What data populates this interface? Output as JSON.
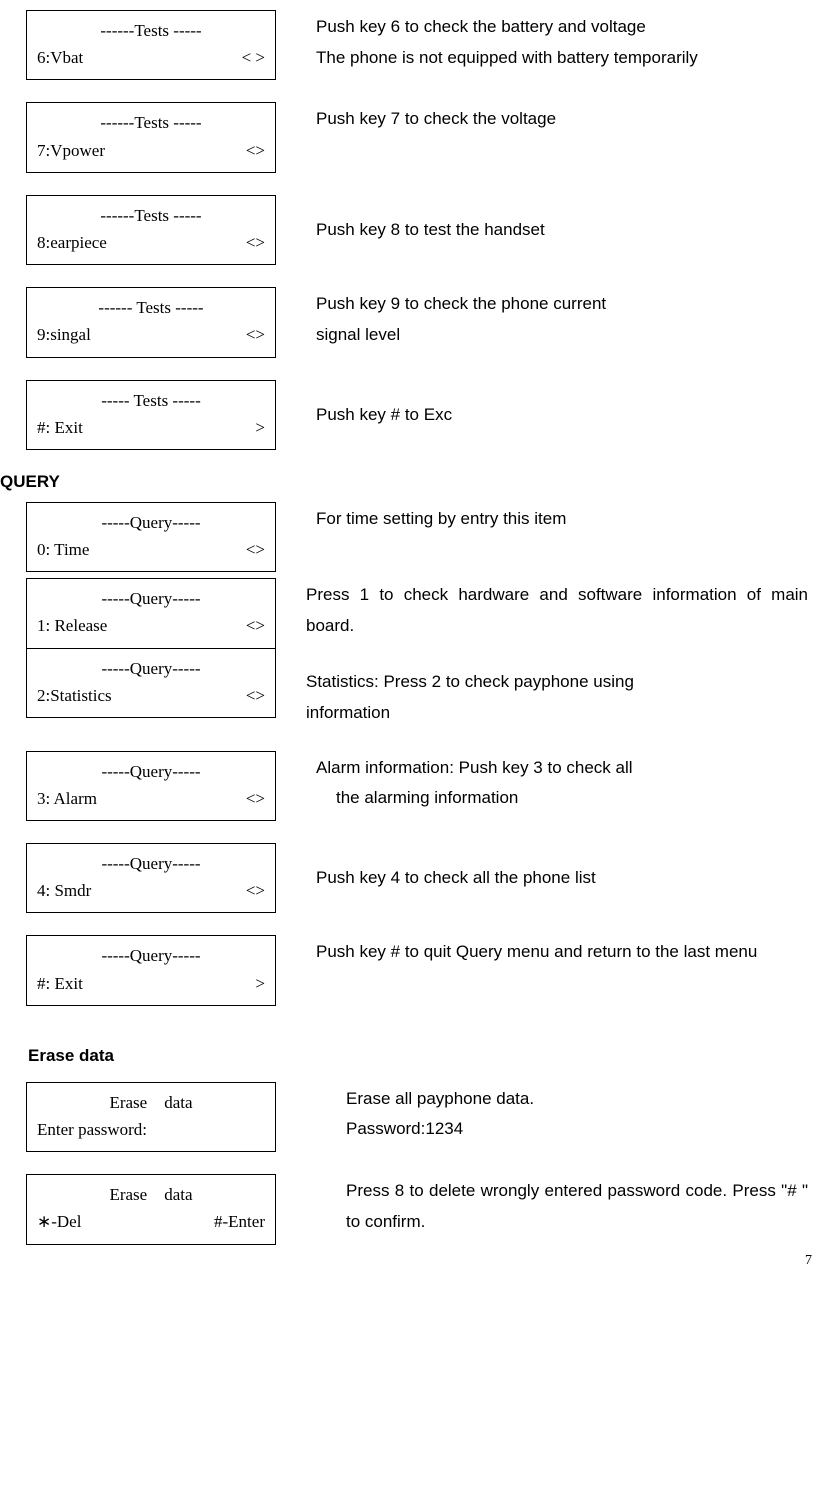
{
  "tests": [
    {
      "hdr": "------Tests -----",
      "left": "6:Vbat",
      "right": "< >",
      "desc": [
        "Push key 6 to check the battery and voltage",
        "The phone is not equipped with battery temporarily"
      ]
    },
    {
      "hdr": "------Tests -----",
      "left": "7:Vpower",
      "right": "<>",
      "desc": [
        "Push key 7 to check the voltage"
      ]
    },
    {
      "hdr": "------Tests -----",
      "left": "8:earpiece",
      "right": "<>",
      "desc": [
        "Push key 8 to test the handset"
      ]
    },
    {
      "hdr": "------ Tests -----",
      "left": "9:singal",
      "right": "<>",
      "desc": [
        "Push key 9 to check the phone current",
        "signal level"
      ]
    },
    {
      "hdr": "----- Tests -----",
      "left": "#: Exit",
      "right": ">",
      "desc": [
        "Push key # to Exc"
      ]
    }
  ],
  "query_heading": "QUERY",
  "query": [
    {
      "hdr": "-----Query-----",
      "left": "0: Time",
      "right": "<>",
      "desc": [
        "For time setting by entry this item"
      ]
    },
    {
      "hdr": "-----Query-----",
      "left": "1: Release",
      "right": "<>",
      "desc": [
        "Press 1 to check hardware and software information of main board."
      ]
    },
    {
      "hdr": "-----Query-----",
      "left": "2:Statistics",
      "right": "<>",
      "desc": [
        "Statistics: Press 2 to check payphone using",
        "information"
      ]
    },
    {
      "hdr": "-----Query-----",
      "left": "3: Alarm",
      "right": "<>",
      "desc": [
        "Alarm information: Push key 3 to check all"
      ],
      "desc_indent": "the alarming information"
    },
    {
      "hdr": "-----Query-----",
      "left": "4: Smdr",
      "right": "<>",
      "desc": [
        "Push key 4 to check all the phone list"
      ]
    },
    {
      "hdr": "-----Query-----",
      "left": "#: Exit",
      "right": ">",
      "desc": [
        "Push key # to quit Query menu and return to the last menu"
      ]
    }
  ],
  "erase_heading": "Erase data",
  "erase": [
    {
      "hdr": "Erase    data",
      "left": "Enter password:",
      "right": "",
      "desc": [
        "Erase all payphone data.",
        "Password:1234"
      ]
    },
    {
      "hdr": "Erase    data",
      "left": "∗-Del",
      "right": "#-Enter",
      "desc": [
        "Press 8 to delete wrongly entered password code. Press \"# \" to confirm."
      ]
    }
  ],
  "page_number": "7"
}
